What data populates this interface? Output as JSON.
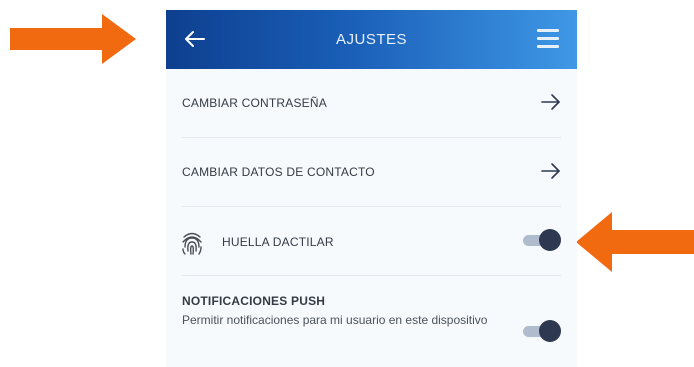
{
  "header": {
    "title": "AJUSTES",
    "back_icon": "arrow-left-icon",
    "menu_icon": "hamburger-menu-icon",
    "gradient_start": "#0e3f8f",
    "gradient_end": "#3f98e6"
  },
  "settings": {
    "change_password": {
      "label": "CAMBIAR CONTRASEÑA",
      "icon": "arrow-right-icon"
    },
    "change_contact": {
      "label": "CAMBIAR DATOS DE CONTACTO",
      "icon": "arrow-right-icon"
    },
    "fingerprint": {
      "label": "HUELLA DACTILAR",
      "icon": "fingerprint-icon",
      "enabled": true
    },
    "push": {
      "title": "NOTIFICACIONES PUSH",
      "description": "Permitir notificaciones para mi usuario en este dispositivo",
      "enabled": true
    }
  },
  "annotations": {
    "arrow_color": "#f26a10"
  }
}
